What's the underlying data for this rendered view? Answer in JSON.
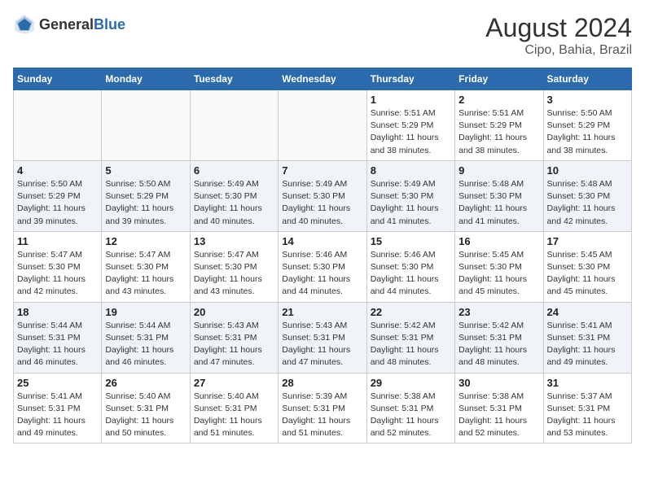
{
  "header": {
    "logo_general": "General",
    "logo_blue": "Blue",
    "month_year": "August 2024",
    "location": "Cipo, Bahia, Brazil"
  },
  "days_of_week": [
    "Sunday",
    "Monday",
    "Tuesday",
    "Wednesday",
    "Thursday",
    "Friday",
    "Saturday"
  ],
  "weeks": [
    [
      {
        "day": "",
        "info": ""
      },
      {
        "day": "",
        "info": ""
      },
      {
        "day": "",
        "info": ""
      },
      {
        "day": "",
        "info": ""
      },
      {
        "day": "1",
        "info": "Sunrise: 5:51 AM\nSunset: 5:29 PM\nDaylight: 11 hours\nand 38 minutes."
      },
      {
        "day": "2",
        "info": "Sunrise: 5:51 AM\nSunset: 5:29 PM\nDaylight: 11 hours\nand 38 minutes."
      },
      {
        "day": "3",
        "info": "Sunrise: 5:50 AM\nSunset: 5:29 PM\nDaylight: 11 hours\nand 38 minutes."
      }
    ],
    [
      {
        "day": "4",
        "info": "Sunrise: 5:50 AM\nSunset: 5:29 PM\nDaylight: 11 hours\nand 39 minutes."
      },
      {
        "day": "5",
        "info": "Sunrise: 5:50 AM\nSunset: 5:29 PM\nDaylight: 11 hours\nand 39 minutes."
      },
      {
        "day": "6",
        "info": "Sunrise: 5:49 AM\nSunset: 5:30 PM\nDaylight: 11 hours\nand 40 minutes."
      },
      {
        "day": "7",
        "info": "Sunrise: 5:49 AM\nSunset: 5:30 PM\nDaylight: 11 hours\nand 40 minutes."
      },
      {
        "day": "8",
        "info": "Sunrise: 5:49 AM\nSunset: 5:30 PM\nDaylight: 11 hours\nand 41 minutes."
      },
      {
        "day": "9",
        "info": "Sunrise: 5:48 AM\nSunset: 5:30 PM\nDaylight: 11 hours\nand 41 minutes."
      },
      {
        "day": "10",
        "info": "Sunrise: 5:48 AM\nSunset: 5:30 PM\nDaylight: 11 hours\nand 42 minutes."
      }
    ],
    [
      {
        "day": "11",
        "info": "Sunrise: 5:47 AM\nSunset: 5:30 PM\nDaylight: 11 hours\nand 42 minutes."
      },
      {
        "day": "12",
        "info": "Sunrise: 5:47 AM\nSunset: 5:30 PM\nDaylight: 11 hours\nand 43 minutes."
      },
      {
        "day": "13",
        "info": "Sunrise: 5:47 AM\nSunset: 5:30 PM\nDaylight: 11 hours\nand 43 minutes."
      },
      {
        "day": "14",
        "info": "Sunrise: 5:46 AM\nSunset: 5:30 PM\nDaylight: 11 hours\nand 44 minutes."
      },
      {
        "day": "15",
        "info": "Sunrise: 5:46 AM\nSunset: 5:30 PM\nDaylight: 11 hours\nand 44 minutes."
      },
      {
        "day": "16",
        "info": "Sunrise: 5:45 AM\nSunset: 5:30 PM\nDaylight: 11 hours\nand 45 minutes."
      },
      {
        "day": "17",
        "info": "Sunrise: 5:45 AM\nSunset: 5:30 PM\nDaylight: 11 hours\nand 45 minutes."
      }
    ],
    [
      {
        "day": "18",
        "info": "Sunrise: 5:44 AM\nSunset: 5:31 PM\nDaylight: 11 hours\nand 46 minutes."
      },
      {
        "day": "19",
        "info": "Sunrise: 5:44 AM\nSunset: 5:31 PM\nDaylight: 11 hours\nand 46 minutes."
      },
      {
        "day": "20",
        "info": "Sunrise: 5:43 AM\nSunset: 5:31 PM\nDaylight: 11 hours\nand 47 minutes."
      },
      {
        "day": "21",
        "info": "Sunrise: 5:43 AM\nSunset: 5:31 PM\nDaylight: 11 hours\nand 47 minutes."
      },
      {
        "day": "22",
        "info": "Sunrise: 5:42 AM\nSunset: 5:31 PM\nDaylight: 11 hours\nand 48 minutes."
      },
      {
        "day": "23",
        "info": "Sunrise: 5:42 AM\nSunset: 5:31 PM\nDaylight: 11 hours\nand 48 minutes."
      },
      {
        "day": "24",
        "info": "Sunrise: 5:41 AM\nSunset: 5:31 PM\nDaylight: 11 hours\nand 49 minutes."
      }
    ],
    [
      {
        "day": "25",
        "info": "Sunrise: 5:41 AM\nSunset: 5:31 PM\nDaylight: 11 hours\nand 49 minutes."
      },
      {
        "day": "26",
        "info": "Sunrise: 5:40 AM\nSunset: 5:31 PM\nDaylight: 11 hours\nand 50 minutes."
      },
      {
        "day": "27",
        "info": "Sunrise: 5:40 AM\nSunset: 5:31 PM\nDaylight: 11 hours\nand 51 minutes."
      },
      {
        "day": "28",
        "info": "Sunrise: 5:39 AM\nSunset: 5:31 PM\nDaylight: 11 hours\nand 51 minutes."
      },
      {
        "day": "29",
        "info": "Sunrise: 5:38 AM\nSunset: 5:31 PM\nDaylight: 11 hours\nand 52 minutes."
      },
      {
        "day": "30",
        "info": "Sunrise: 5:38 AM\nSunset: 5:31 PM\nDaylight: 11 hours\nand 52 minutes."
      },
      {
        "day": "31",
        "info": "Sunrise: 5:37 AM\nSunset: 5:31 PM\nDaylight: 11 hours\nand 53 minutes."
      }
    ]
  ]
}
